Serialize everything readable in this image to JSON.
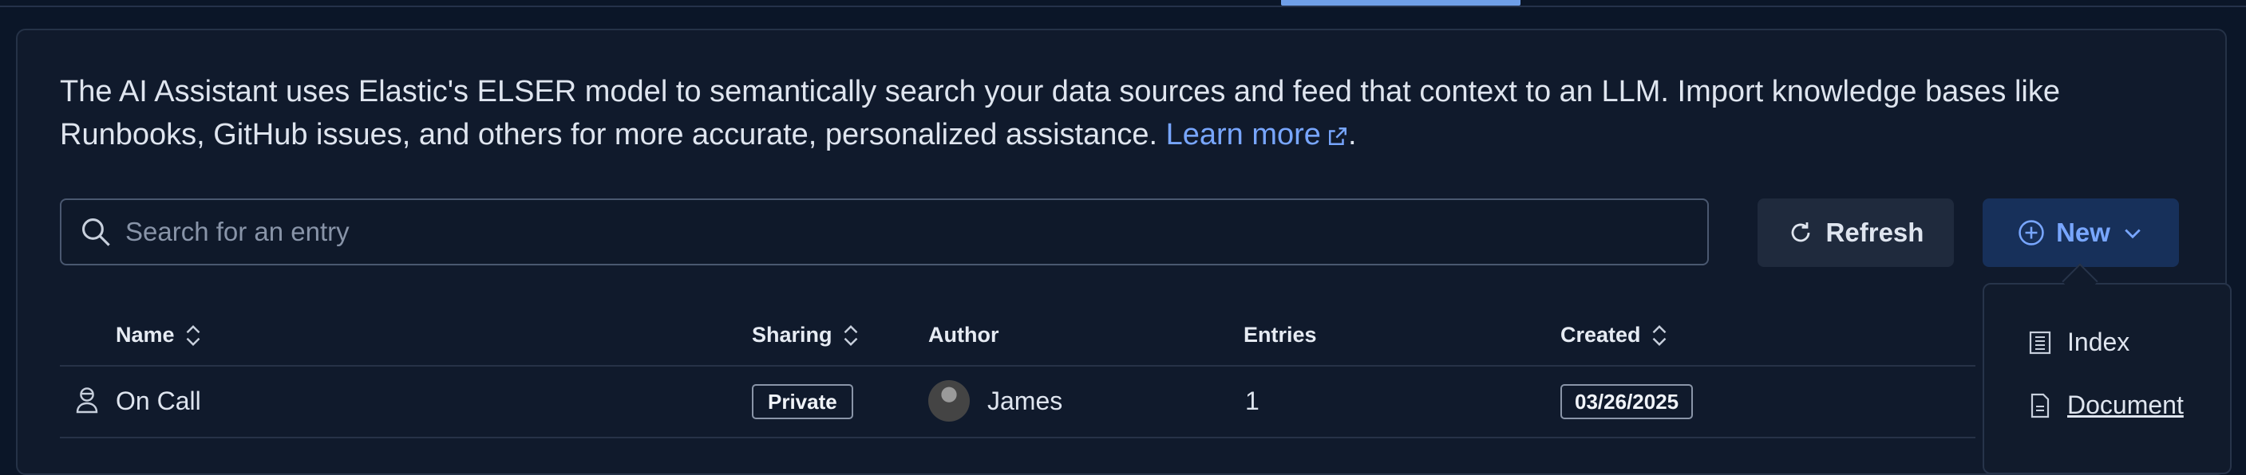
{
  "description": {
    "text": "The AI Assistant uses Elastic's ELSER model to semantically search your data sources and feed that context to an LLM. Import knowledge bases like Runbooks, GitHub issues, and others for more accurate, personalized assistance.",
    "link_label": "Learn more",
    "suffix": "."
  },
  "search": {
    "placeholder": "Search for an entry",
    "value": ""
  },
  "toolbar": {
    "refresh_label": "Refresh",
    "new_label": "New"
  },
  "table": {
    "headers": {
      "name": "Name",
      "sharing": "Sharing",
      "author": "Author",
      "entries": "Entries",
      "created": "Created"
    },
    "rows": [
      {
        "name": "On Call",
        "sharing": "Private",
        "author": "James",
        "entries": "1",
        "created": "03/26/2025"
      }
    ]
  },
  "new_menu": {
    "items": [
      {
        "label": "Index",
        "icon": "index-icon"
      },
      {
        "label": "Document",
        "icon": "document-icon"
      }
    ]
  },
  "colors": {
    "accent": "#78a6ff",
    "new_button_bg": "#17305a",
    "background": "#0b1628"
  }
}
